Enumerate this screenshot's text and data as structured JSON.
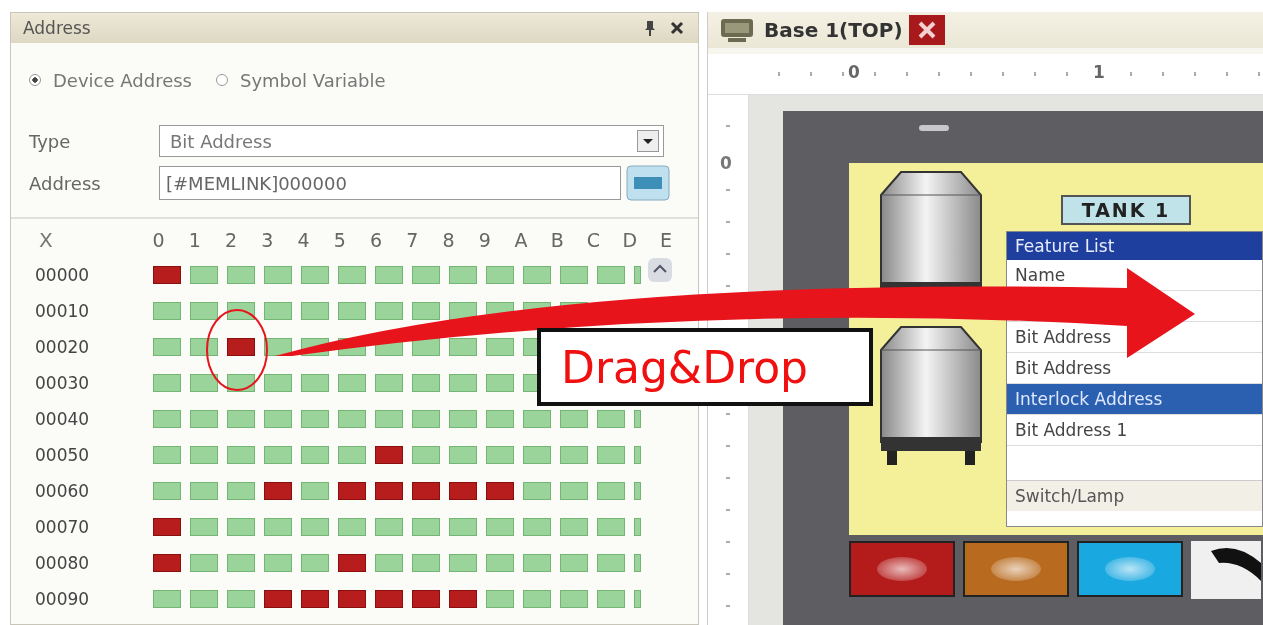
{
  "panel": {
    "title": "Address"
  },
  "source": {
    "options": [
      {
        "label": "Device Address",
        "selected": true
      },
      {
        "label": "Symbol Variable",
        "selected": false
      }
    ]
  },
  "type_field": {
    "label": "Type",
    "value": "Bit Address"
  },
  "address_field": {
    "label": "Address",
    "value": "[#MEMLINK]000000"
  },
  "bit_grid": {
    "corner": "X",
    "columns": [
      "0",
      "1",
      "2",
      "3",
      "4",
      "5",
      "6",
      "7",
      "8",
      "9",
      "A",
      "B",
      "C",
      "D",
      "E"
    ],
    "rows": [
      {
        "address": "00000",
        "bits": [
          true,
          false,
          false,
          false,
          false,
          false,
          false,
          false,
          false,
          false,
          false,
          false,
          false,
          false
        ]
      },
      {
        "address": "00010",
        "bits": [
          false,
          false,
          false,
          false,
          false,
          false,
          false,
          false,
          false,
          false,
          false,
          false
        ]
      },
      {
        "address": "00020",
        "bits": [
          false,
          false,
          true,
          false,
          false,
          false,
          false,
          false,
          false,
          false,
          false
        ]
      },
      {
        "address": "00030",
        "bits": [
          false,
          false,
          false,
          false,
          false,
          false,
          false,
          false,
          false,
          false,
          false
        ]
      },
      {
        "address": "00040",
        "bits": [
          false,
          false,
          false,
          false,
          false,
          false,
          false,
          false,
          false,
          false,
          false,
          false,
          false,
          false
        ]
      },
      {
        "address": "00050",
        "bits": [
          false,
          false,
          false,
          false,
          false,
          false,
          true,
          false,
          false,
          false,
          false,
          false,
          false,
          false
        ]
      },
      {
        "address": "00060",
        "bits": [
          false,
          false,
          false,
          true,
          false,
          true,
          true,
          true,
          true,
          true,
          false,
          false,
          false,
          false
        ]
      },
      {
        "address": "00070",
        "bits": [
          true,
          false,
          false,
          false,
          false,
          false,
          false,
          false,
          false,
          false,
          false,
          false,
          false,
          false
        ]
      },
      {
        "address": "00080",
        "bits": [
          true,
          false,
          false,
          false,
          false,
          true,
          false,
          false,
          false,
          false,
          false,
          false,
          false,
          false
        ]
      },
      {
        "address": "00090",
        "bits": [
          false,
          false,
          false,
          true,
          true,
          true,
          true,
          true,
          true,
          false,
          false,
          false,
          false,
          false
        ]
      }
    ]
  },
  "editor": {
    "tab": {
      "title": "Base 1(TOP)"
    },
    "ruler": {
      "h_labels": [
        "0",
        "1"
      ],
      "v_labels": [
        "0"
      ]
    },
    "tank_label": "TANK 1",
    "feature_list": {
      "title": "Feature List",
      "items": [
        {
          "label": "Name",
          "selected": false
        },
        {
          "label": "Bit Address",
          "selected": false
        },
        {
          "label": "Bit Address",
          "selected": false
        },
        {
          "label": "Interlock Address",
          "selected": true
        },
        {
          "label": "Bit Address 1",
          "selected": false
        }
      ],
      "footer": "Switch/Lamp"
    },
    "lamps": [
      {
        "color": "#b41c1c"
      },
      {
        "color": "#b86a1e"
      },
      {
        "color": "#1aa8e0"
      }
    ]
  },
  "annotation": {
    "label": "Drag&Drop"
  }
}
